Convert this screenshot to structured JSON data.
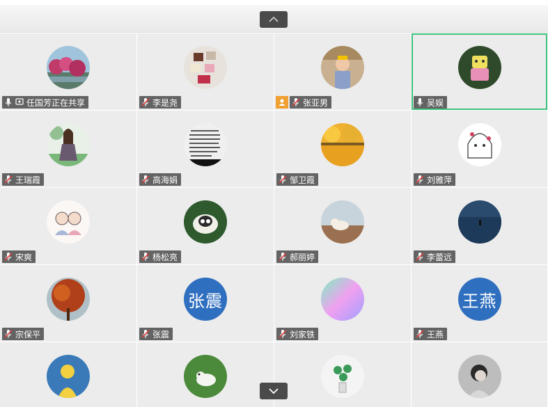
{
  "participants": [
    {
      "name": "任国芳正在共享",
      "mic": "on",
      "sharing": true,
      "avatar": "photo-flowers"
    },
    {
      "name": "李是尧",
      "mic": "muted",
      "avatar": "photo-food"
    },
    {
      "name": "张亚男",
      "mic": "muted",
      "host": true,
      "avatar": "photo-child"
    },
    {
      "name": "吴娱",
      "mic": "on",
      "active": true,
      "avatar": "photo-toy"
    },
    {
      "name": "王瑞霞",
      "mic": "muted",
      "avatar": "photo-girl-tree"
    },
    {
      "name": "高海娟",
      "mic": "muted",
      "avatar": "photo-text-page"
    },
    {
      "name": "邹卫霞",
      "mic": "muted",
      "avatar": "photo-autumn-lake"
    },
    {
      "name": "刘雅萍",
      "mic": "muted",
      "avatar": "drawing-girl"
    },
    {
      "name": "宋爽",
      "mic": "muted",
      "avatar": "drawing-couple"
    },
    {
      "name": "杨松亮",
      "mic": "muted",
      "avatar": "photo-sheep"
    },
    {
      "name": "郝丽婷",
      "mic": "muted",
      "avatar": "photo-cat"
    },
    {
      "name": "李蕾远",
      "mic": "muted",
      "avatar": "photo-sea"
    },
    {
      "name": "宗保平",
      "mic": "muted",
      "avatar": "photo-red-tree"
    },
    {
      "name": "张震",
      "mic": "muted",
      "avatar_text": "张震"
    },
    {
      "name": "刘家铁",
      "mic": "muted",
      "avatar": "photo-colorful"
    },
    {
      "name": "王燕",
      "mic": "muted",
      "avatar_text": "王燕"
    },
    {
      "name": "",
      "avatar": "photo-yellow-figure"
    },
    {
      "name": "",
      "avatar": "photo-dog"
    },
    {
      "name": "",
      "avatar": "photo-plant"
    },
    {
      "name": "",
      "avatar": "photo-person-bw"
    }
  ],
  "icons": {
    "scroll_up": "chevron-up-icon",
    "scroll_down": "chevron-down-icon",
    "mic_on": "microphone-icon",
    "mic_muted": "microphone-muted-icon",
    "share": "screen-share-icon",
    "host": "host-person-icon"
  },
  "colors": {
    "active_border": "#3fbf7f",
    "label_bg": "#3c3c3c",
    "host_badge": "#f0a030",
    "text_avatar_bg": "#2f6fbf"
  }
}
